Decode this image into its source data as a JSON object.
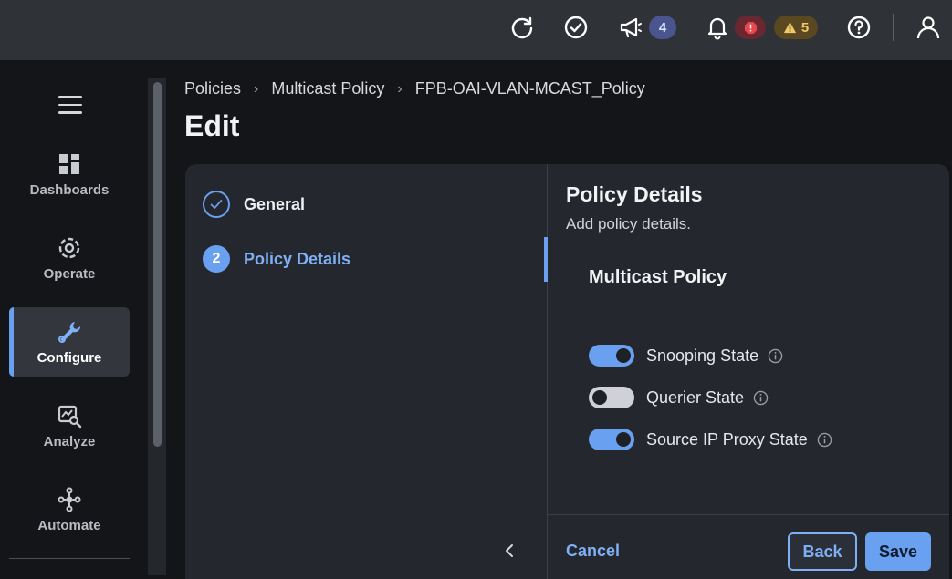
{
  "topbar": {
    "icons": [
      "refresh-icon",
      "check-circle-icon",
      "megaphone-icon",
      "bell-icon",
      "help-icon",
      "user-icon"
    ],
    "announcements_count": "4",
    "warnings_count": "5"
  },
  "nav": {
    "items": [
      {
        "label": "Dashboards",
        "icon": "dashboards-icon"
      },
      {
        "label": "Operate",
        "icon": "operate-icon"
      },
      {
        "label": "Configure",
        "icon": "wrench-icon",
        "active": true
      },
      {
        "label": "Analyze",
        "icon": "analyze-icon"
      },
      {
        "label": "Automate",
        "icon": "automate-icon"
      }
    ]
  },
  "breadcrumb": [
    "Policies",
    "Multicast Policy",
    "FPB-OAI-VLAN-MCAST_Policy"
  ],
  "page_title": "Edit",
  "wizard": {
    "steps": [
      {
        "number": "1",
        "label": "General",
        "state": "done"
      },
      {
        "number": "2",
        "label": "Policy Details",
        "state": "current"
      }
    ]
  },
  "details": {
    "title": "Policy Details",
    "subtitle": "Add policy details.",
    "section_title": "Multicast Policy",
    "toggles": [
      {
        "label": "Snooping State",
        "on": true
      },
      {
        "label": "Querier State",
        "on": false
      },
      {
        "label": "Source IP Proxy State",
        "on": true
      }
    ]
  },
  "footer": {
    "cancel_label": "Cancel",
    "back_label": "Back",
    "save_label": "Save"
  },
  "colors": {
    "accent": "#6aa0f0",
    "error": "#e5484d",
    "warning": "#f3c76b"
  }
}
